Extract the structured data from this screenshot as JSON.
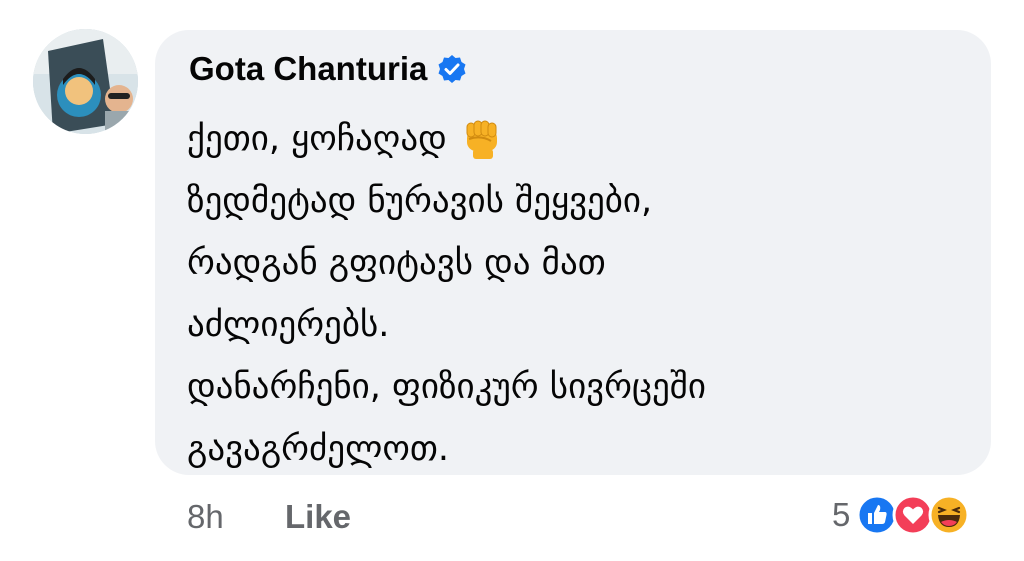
{
  "comment": {
    "author": "Gota Chanturia",
    "verified_icon": "verified-badge-icon",
    "avatar_icon": "profile-photo",
    "lines": [
      "ქეთი, ყოჩაღად",
      "ზედმეტად ნურავის შეყვები,",
      "რადგან გფიტავს და მათ",
      "აძლიერებს.",
      "დანარჩენი, ფიზიკურ სივრცეში",
      "გავაგრძელოთ."
    ],
    "emoji": "raised-fist-emoji"
  },
  "footer": {
    "time": "8h",
    "like_label": "Like",
    "reaction_count": "5",
    "reaction_icons": [
      "like-reaction-icon",
      "love-reaction-icon",
      "haha-reaction-icon"
    ]
  },
  "colors": {
    "bubble": "#f0f2f5",
    "text": "#050505",
    "meta": "#65676b",
    "verified": "#1877f2",
    "like": "#1877f2",
    "love": "#f33e58",
    "haha": "#f7b125"
  }
}
